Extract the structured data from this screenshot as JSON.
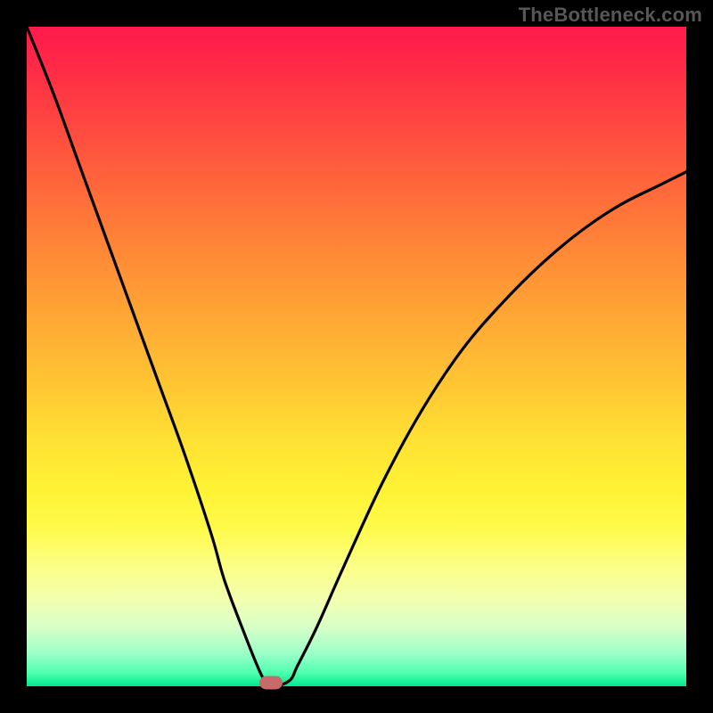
{
  "watermark": "TheBottleneck.com",
  "chart_data": {
    "type": "line",
    "title": "",
    "xlabel": "",
    "ylabel": "",
    "xlim": [
      0,
      100
    ],
    "ylim": [
      0,
      100
    ],
    "grid": false,
    "background_gradient": {
      "direction": "vertical",
      "top_color": "#ff1a4b",
      "bottom_color": "#00e88a",
      "description": "red-to-green heat gradient (bottleneck severity)"
    },
    "series": [
      {
        "name": "bottleneck-curve",
        "color": "#000000",
        "x": [
          0,
          4,
          8,
          12,
          16,
          20,
          24,
          28,
          30,
          33,
          35,
          36,
          37,
          38,
          40,
          41,
          44,
          48,
          54,
          60,
          66,
          72,
          78,
          84,
          90,
          96,
          100
        ],
        "y": [
          100,
          90,
          79,
          68,
          57,
          46,
          35,
          23,
          16,
          8,
          3,
          1,
          0,
          0,
          1,
          3,
          9,
          18,
          31,
          42,
          51,
          58,
          64,
          69,
          73,
          76,
          78
        ]
      }
    ],
    "marker": {
      "name": "optimal-point",
      "x": 37,
      "y": 0,
      "color": "#c76a6a",
      "shape": "rounded-rect"
    }
  }
}
